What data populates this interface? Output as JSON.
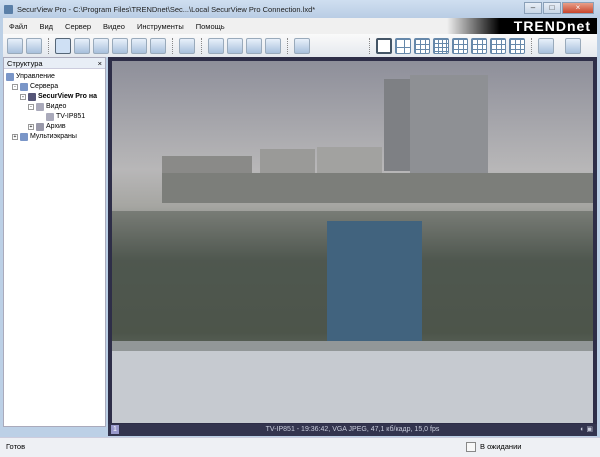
{
  "window": {
    "title": "SecurView Pro - C:\\Program Files\\TRENDnet\\Sec...\\Local SecurView Pro Connection.lxd*"
  },
  "menu": [
    "Файл",
    "Вид",
    "Сервер",
    "Видео",
    "Инструменты",
    "Помощь"
  ],
  "brand": "TRENDnet",
  "panel": {
    "title": "Структура",
    "close": "×",
    "tree": [
      {
        "label": "Управление"
      },
      {
        "label": "Сервера"
      },
      {
        "label": "SecurView Pro на"
      },
      {
        "label": "Видео"
      },
      {
        "label": "TV-IP851"
      },
      {
        "label": "Архив"
      },
      {
        "label": "Мультиэкраны"
      }
    ]
  },
  "video": {
    "channel": "1",
    "status": "TV-IP851 - 19:36:42, VGA JPEG, 47,1 кб/кадр, 15,0 fps"
  },
  "statusbar": {
    "left": "Готов",
    "right": "В ожидании"
  }
}
